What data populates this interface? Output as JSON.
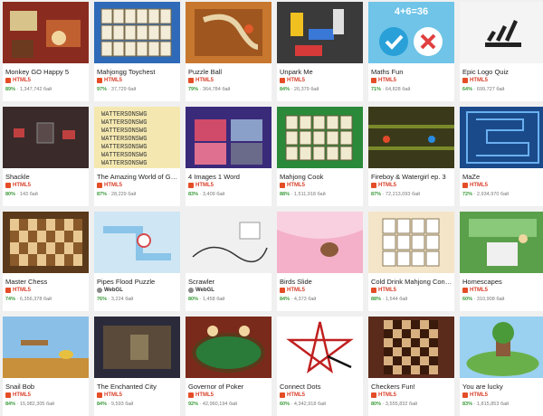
{
  "games": [
    {
      "title": "Monkey GO Happy 5",
      "tech": "HTML5",
      "rating": "89%",
      "plays": "1,347,742 бай"
    },
    {
      "title": "Mahjongg Toychest",
      "tech": "HTML5",
      "rating": "97%",
      "plays": "37,729 бай"
    },
    {
      "title": "Puzzle Ball",
      "tech": "HTML5",
      "rating": "79%",
      "plays": "364,784 бай"
    },
    {
      "title": "Unpark Me",
      "tech": "HTML5",
      "rating": "84%",
      "plays": "26,379 бай"
    },
    {
      "title": "Maths Fun",
      "tech": "HTML5",
      "rating": "71%",
      "plays": "64,828 бай"
    },
    {
      "title": "Epic Logo Quiz",
      "tech": "HTML5",
      "rating": "64%",
      "plays": "699,727 бай"
    },
    {
      "title": "Shackle",
      "tech": "HTML5",
      "rating": "80%",
      "plays": "143 бай"
    },
    {
      "title": "The Amazing World of Gu...",
      "tech": "HTML5",
      "rating": "87%",
      "plays": "28,229 бай"
    },
    {
      "title": "4 Images 1 Word",
      "tech": "HTML5",
      "rating": "83%",
      "plays": "3,409 бай"
    },
    {
      "title": "Mahjong Cook",
      "tech": "HTML5",
      "rating": "88%",
      "plays": "1,511,918 бай"
    },
    {
      "title": "Fireboy & Watergirl ep. 3",
      "tech": "HTML5",
      "rating": "87%",
      "plays": "72,213,093 бай"
    },
    {
      "title": "MaZe",
      "tech": "HTML5",
      "rating": "72%",
      "plays": "2,934,970 бай"
    },
    {
      "title": "Master Chess",
      "tech": "HTML5",
      "rating": "74%",
      "plays": "6,356,378 бай"
    },
    {
      "title": "Pipes Flood Puzzle",
      "tech": "WebGL",
      "rating": "76%",
      "plays": "3,224 бай"
    },
    {
      "title": "Scrawler",
      "tech": "WebGL",
      "rating": "80%",
      "plays": "1,458 бай"
    },
    {
      "title": "Birds Slide",
      "tech": "HTML5",
      "rating": "84%",
      "plays": "4,373 бай"
    },
    {
      "title": "Cold Drink Mahjong Conn...",
      "tech": "HTML5",
      "rating": "88%",
      "plays": "1,544 бай"
    },
    {
      "title": "Homescapes",
      "tech": "HTML5",
      "rating": "60%",
      "plays": "310,908 бай"
    },
    {
      "title": "Snail Bob",
      "tech": "HTML5",
      "rating": "84%",
      "plays": "15,982,305 бай"
    },
    {
      "title": "The Enchanted City",
      "tech": "HTML5",
      "rating": "84%",
      "plays": "9,593 бай"
    },
    {
      "title": "Governor of Poker",
      "tech": "HTML5",
      "rating": "92%",
      "plays": "42,960,194 бай"
    },
    {
      "title": "Connect Dots",
      "tech": "HTML5",
      "rating": "60%",
      "plays": "4,342,918 бай"
    },
    {
      "title": "Checkers Fun!",
      "tech": "HTML5",
      "rating": "80%",
      "plays": "3,555,832 бай"
    },
    {
      "title": "You are lucky",
      "tech": "HTML5",
      "rating": "83%",
      "plays": "1,815,853 бай"
    }
  ],
  "thumb_texts": {
    "maths_equation": "4+6=36"
  },
  "colors": {
    "rating_green": "#3a9a3a",
    "html5_red": "#d9402b",
    "page_bg": "#f0f0f0"
  }
}
